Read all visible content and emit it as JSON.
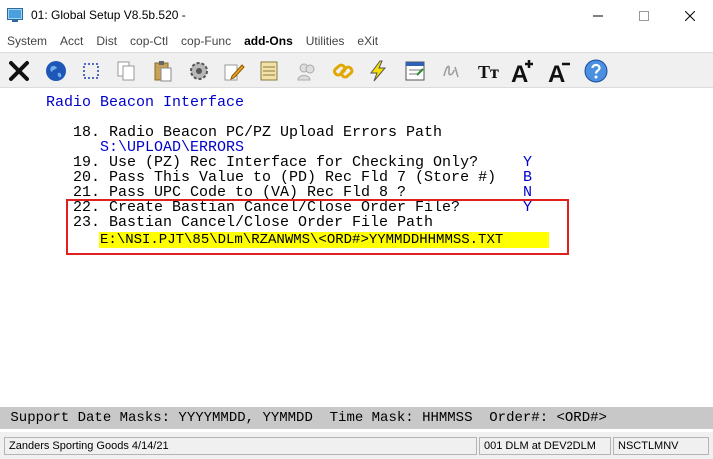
{
  "window": {
    "title": "01: Global Setup V8.5b.520 -"
  },
  "menu": {
    "items": [
      "System",
      "Acct",
      "Dist",
      "cop-Ctl",
      "cop-Func",
      "add-Ons",
      "Utilities",
      "eXit"
    ]
  },
  "toolbar": {
    "icons": [
      "close-x-icon",
      "globe-icon",
      "select-icon",
      "copy-icon",
      "paste-icon",
      "settings-icon",
      "edit-icon",
      "list-icon",
      "users-icon",
      "link-icon",
      "lightning-icon",
      "form-icon",
      "script-icon",
      "font-icon",
      "font-larger-icon",
      "font-smaller-icon",
      "help-icon"
    ],
    "font_larger_label": "A",
    "font_smaller_label": "A",
    "font_label": "Tт"
  },
  "screen": {
    "heading": "Radio Beacon Interface",
    "fields": [
      {
        "label": "18. Radio Beacon PC/PZ Upload Errors Path",
        "value": "S:\\UPLOAD\\ERRORS"
      },
      {
        "label": "19. Use (PZ) Rec Interface for Checking Only?",
        "value": "Y"
      },
      {
        "label": "20. Pass This Value to (PD) Rec Fld 7 (Store #)",
        "value": "B"
      },
      {
        "label": "21. Pass UPC Code to (VA) Rec Fld 8 ?",
        "value": "N"
      },
      {
        "label": "22. Create Bastian Cancel/Close Order File?",
        "value": "Y"
      },
      {
        "label": "23. Bastian Cancel/Close Order File Path",
        "value": "E:\\NSI.PJT\\85\\DLm\\RZANWMS\\<ORD#>YYMMDDHHMMSS.TXT"
      }
    ]
  },
  "helpline": {
    "text": " Support Date Masks: YYYYMMDD, YYMMDD  Time Mask: HHMMSS  Order#: <ORD#>"
  },
  "status": {
    "company": "Zanders Sporting Goods 4/14/21",
    "session": "001 DLM at DEV2DLM",
    "program": "NSCTLMNV"
  },
  "colors": {
    "highlight_border": "#e0201e",
    "field_background": "#ffff00",
    "value_blue": "#0000cc"
  }
}
